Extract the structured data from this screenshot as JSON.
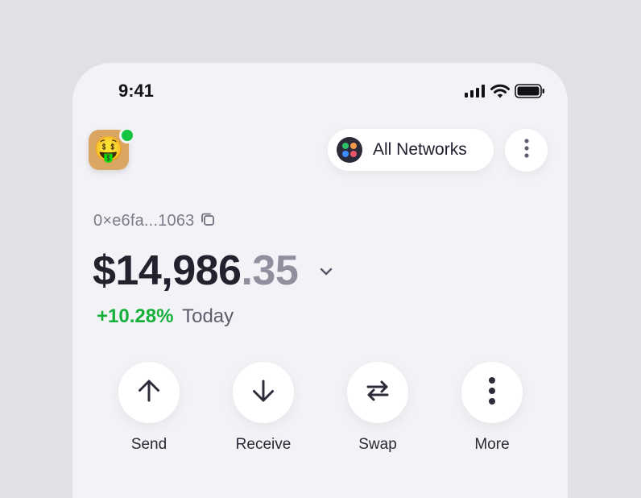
{
  "status_bar": {
    "time": "9:41",
    "icons": [
      "signal-icon",
      "wifi-icon",
      "battery-icon"
    ]
  },
  "header": {
    "avatar_emoji": "🤑",
    "online": true,
    "network_selector": {
      "label": "All Networks",
      "icon": "networks-logo-icon"
    },
    "menu_icon": "vertical-dots-icon"
  },
  "wallet": {
    "address": "0×e6fa...1063",
    "copy_icon": "copy-icon",
    "balance_main": "$14,986",
    "balance_decimal": ".35",
    "balance_toggle_icon": "chevron-down-icon",
    "change_percent": "+10.28%",
    "change_label": "Today"
  },
  "actions": [
    {
      "label": "Send",
      "icon": "arrow-up-icon"
    },
    {
      "label": "Receive",
      "icon": "arrow-down-icon"
    },
    {
      "label": "Swap",
      "icon": "swap-arrows-icon"
    },
    {
      "label": "More",
      "icon": "vertical-dots-icon"
    }
  ],
  "colors": {
    "background": "#dfe1e4",
    "surface": "#f3f3f7",
    "card": "#ffffff",
    "text_primary": "#22222e",
    "text_muted": "#8f8f9e",
    "positive": "#14b03a",
    "online": "#12c440",
    "avatar_bg": "#d9a761"
  }
}
